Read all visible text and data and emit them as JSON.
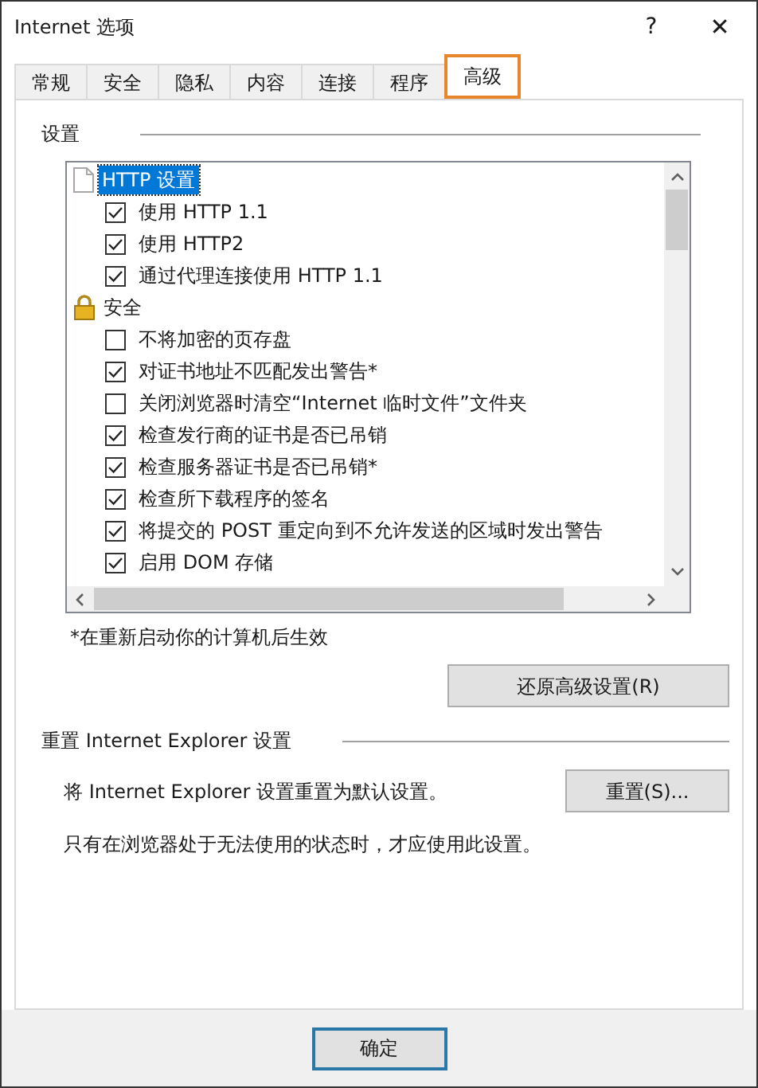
{
  "window": {
    "title": "Internet 选项",
    "help": "?",
    "close": "✕"
  },
  "tabs": [
    {
      "label": "常规",
      "selected": false
    },
    {
      "label": "安全",
      "selected": false
    },
    {
      "label": "隐私",
      "selected": false
    },
    {
      "label": "内容",
      "selected": false
    },
    {
      "label": "连接",
      "selected": false
    },
    {
      "label": "程序",
      "selected": false
    },
    {
      "label": "高级",
      "selected": true
    }
  ],
  "settings": {
    "title": "设置",
    "items": [
      {
        "kind": "group",
        "label": "HTTP 设置",
        "selected": true
      },
      {
        "kind": "checkbox",
        "label": "使用 HTTP 1.1",
        "checked": true
      },
      {
        "kind": "checkbox",
        "label": "使用 HTTP2",
        "checked": true
      },
      {
        "kind": "checkbox",
        "label": "通过代理连接使用 HTTP 1.1",
        "checked": true
      },
      {
        "kind": "group",
        "label": "安全",
        "selected": false
      },
      {
        "kind": "checkbox",
        "label": "不将加密的页存盘",
        "checked": false
      },
      {
        "kind": "checkbox",
        "label": "对证书地址不匹配发出警告*",
        "checked": true
      },
      {
        "kind": "checkbox",
        "label": "关闭浏览器时清空“Internet 临时文件”文件夹",
        "checked": false
      },
      {
        "kind": "checkbox",
        "label": "检查发行商的证书是否已吊销",
        "checked": true
      },
      {
        "kind": "checkbox",
        "label": "检查服务器证书是否已吊销*",
        "checked": true
      },
      {
        "kind": "checkbox",
        "label": "检查所下载程序的签名",
        "checked": true
      },
      {
        "kind": "checkbox",
        "label": "将提交的 POST 重定向到不允许发送的区域时发出警告",
        "checked": true
      },
      {
        "kind": "checkbox",
        "label": "启用 DOM 存储",
        "checked": true
      }
    ],
    "note": "*在重新启动你的计算机后生效",
    "restore_button": "还原高级设置(R)"
  },
  "reset": {
    "title": "重置 Internet Explorer 设置",
    "description": "将 Internet Explorer 设置重置为默认设置。",
    "button": "重置(S)...",
    "hint": "只有在浏览器处于无法使用的状态时，才应使用此设置。"
  },
  "buttons": [
    "确定"
  ]
}
